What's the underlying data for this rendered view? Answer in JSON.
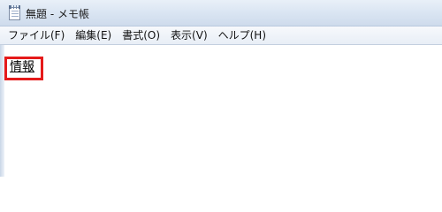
{
  "window": {
    "title": "無題 - メモ帳",
    "app_icon": "notepad-icon"
  },
  "menubar": {
    "items": [
      {
        "label": "ファイル(F)"
      },
      {
        "label": "編集(E)"
      },
      {
        "label": "書式(O)"
      },
      {
        "label": "表示(V)"
      },
      {
        "label": "ヘルプ(H)"
      }
    ]
  },
  "document": {
    "text": "情報",
    "highlight_color": "#e51a1a"
  }
}
